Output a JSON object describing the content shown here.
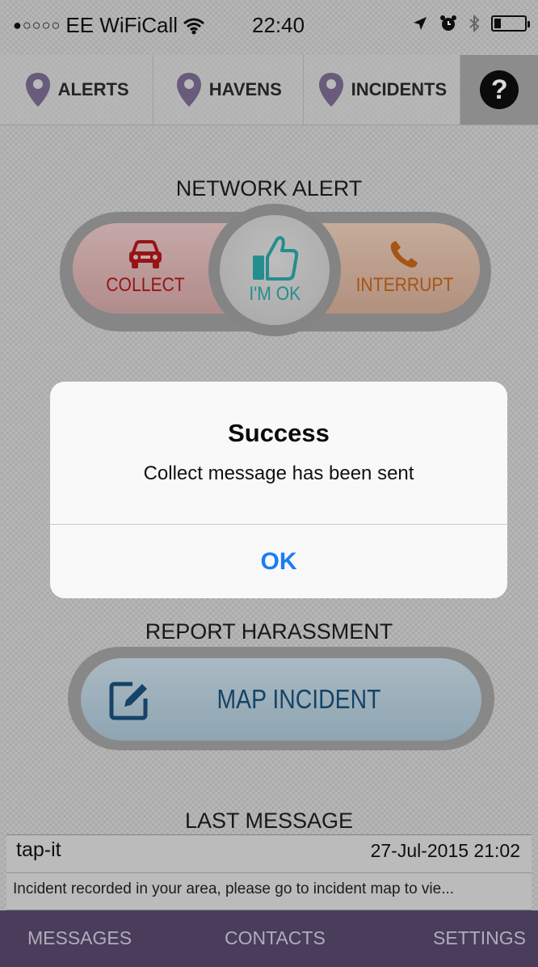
{
  "status_bar": {
    "carrier": "EE WiFiCall",
    "time": "22:40",
    "battery_level": 0.22
  },
  "top_tabs": [
    {
      "label": "ALERTS",
      "icon": "map-pin-icon"
    },
    {
      "label": "HAVENS",
      "icon": "map-pin-icon"
    },
    {
      "label": "INCIDENTS",
      "icon": "map-pin-icon"
    },
    {
      "label": "?",
      "icon": "help-icon"
    }
  ],
  "network_alert": {
    "title": "NETWORK ALERT",
    "collect_label": "COLLECT",
    "ok_label": "I'M OK",
    "interrupt_label": "INTERRUPT"
  },
  "report": {
    "title": "REPORT HARASSMENT",
    "map_incident_label": "MAP INCIDENT"
  },
  "last_message": {
    "title": "LAST MESSAGE",
    "sender": "tap-it",
    "date": "27-Jul-2015 21:02",
    "text": "Incident recorded in your area, please go to incident map to vie..."
  },
  "bottom_tabs": [
    "MESSAGES",
    "CONTACTS",
    "SETTINGS"
  ],
  "dialog": {
    "title": "Success",
    "message": "Collect message has been sent",
    "button": "OK"
  },
  "colors": {
    "collect": "#b01818",
    "ok": "#2aa6a6",
    "interrupt": "#c06418",
    "map_incident": "#1a4f78",
    "bottom_bar": "#56476a",
    "dialog_button": "#1a7cf5"
  }
}
